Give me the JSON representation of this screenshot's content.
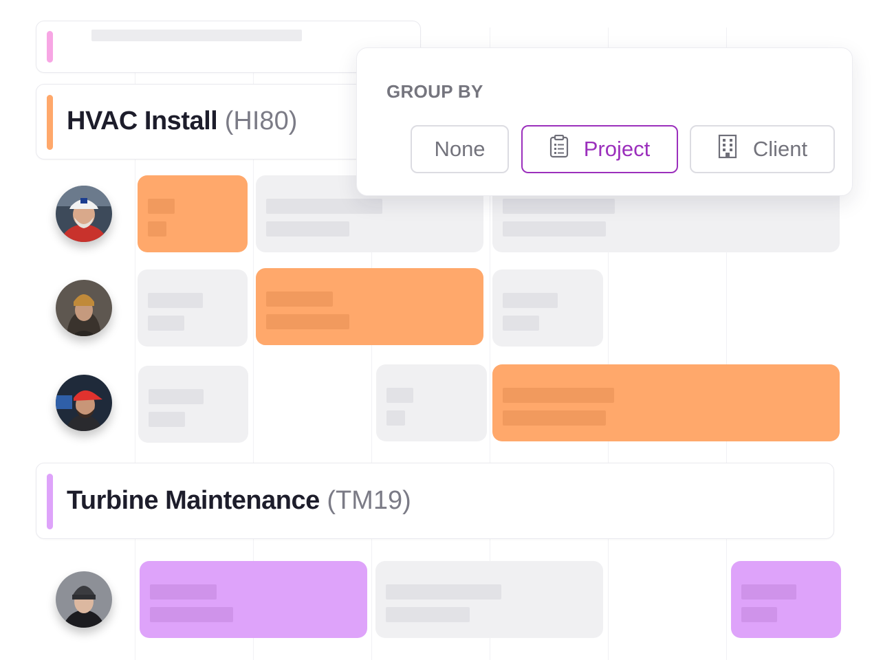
{
  "colors": {
    "accent_orange": "#ffa86b",
    "accent_purple": "#dea3fa",
    "selected": "#9b2fbc",
    "placeholder_grey": "#f0f0f2"
  },
  "groups": [
    {
      "name": "HVAC Install",
      "code": "(HI80)",
      "accent": "#ffa86b"
    },
    {
      "name": "Turbine Maintenance",
      "code": "(TM19)",
      "accent": "#dea3fa"
    }
  ],
  "group_by": {
    "title": "GROUP BY",
    "options": [
      {
        "label": "None",
        "icon": "none",
        "selected": false
      },
      {
        "label": "Project",
        "icon": "clipboard-list-icon",
        "selected": true
      },
      {
        "label": "Client",
        "icon": "building-icon",
        "selected": false
      }
    ]
  }
}
